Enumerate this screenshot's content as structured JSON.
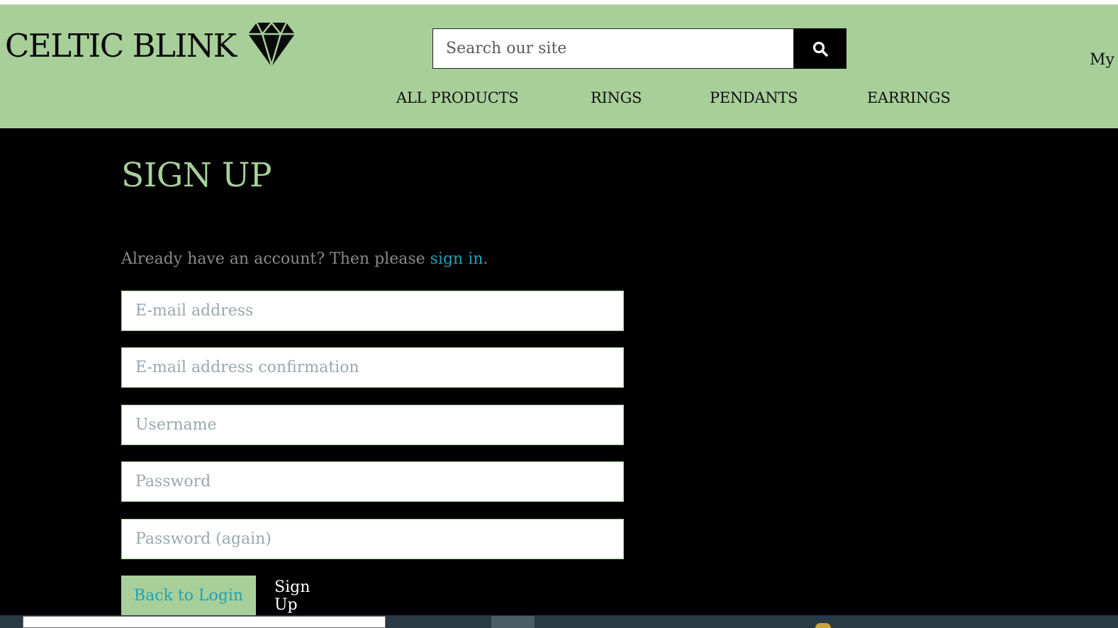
{
  "brand": {
    "name": "CELTIC BLINK",
    "logo_icon": "diamond-gem-icon"
  },
  "search": {
    "placeholder": "Search our site",
    "button_icon": "search-icon"
  },
  "account": {
    "label": "My"
  },
  "nav": {
    "items": [
      {
        "label": "ALL PRODUCTS"
      },
      {
        "label": "RINGS"
      },
      {
        "label": "PENDANTS"
      },
      {
        "label": "EARRINGS"
      }
    ]
  },
  "main": {
    "title": "SIGN UP",
    "prompt_text": "Already have an account? Then please ",
    "prompt_link": "sign in",
    "prompt_end": ".",
    "fields": [
      {
        "placeholder": "E-mail address"
      },
      {
        "placeholder": "E-mail address confirmation"
      },
      {
        "placeholder": "Username"
      },
      {
        "placeholder": "Password"
      },
      {
        "placeholder": "Password (again)"
      }
    ],
    "back_label": "Back to Login",
    "signup_label": "Sign Up"
  },
  "colors": {
    "header_bg": "#a8cf9a",
    "page_bg": "#000000",
    "link": "#1fa3b8",
    "title": "#a8cf9a"
  }
}
